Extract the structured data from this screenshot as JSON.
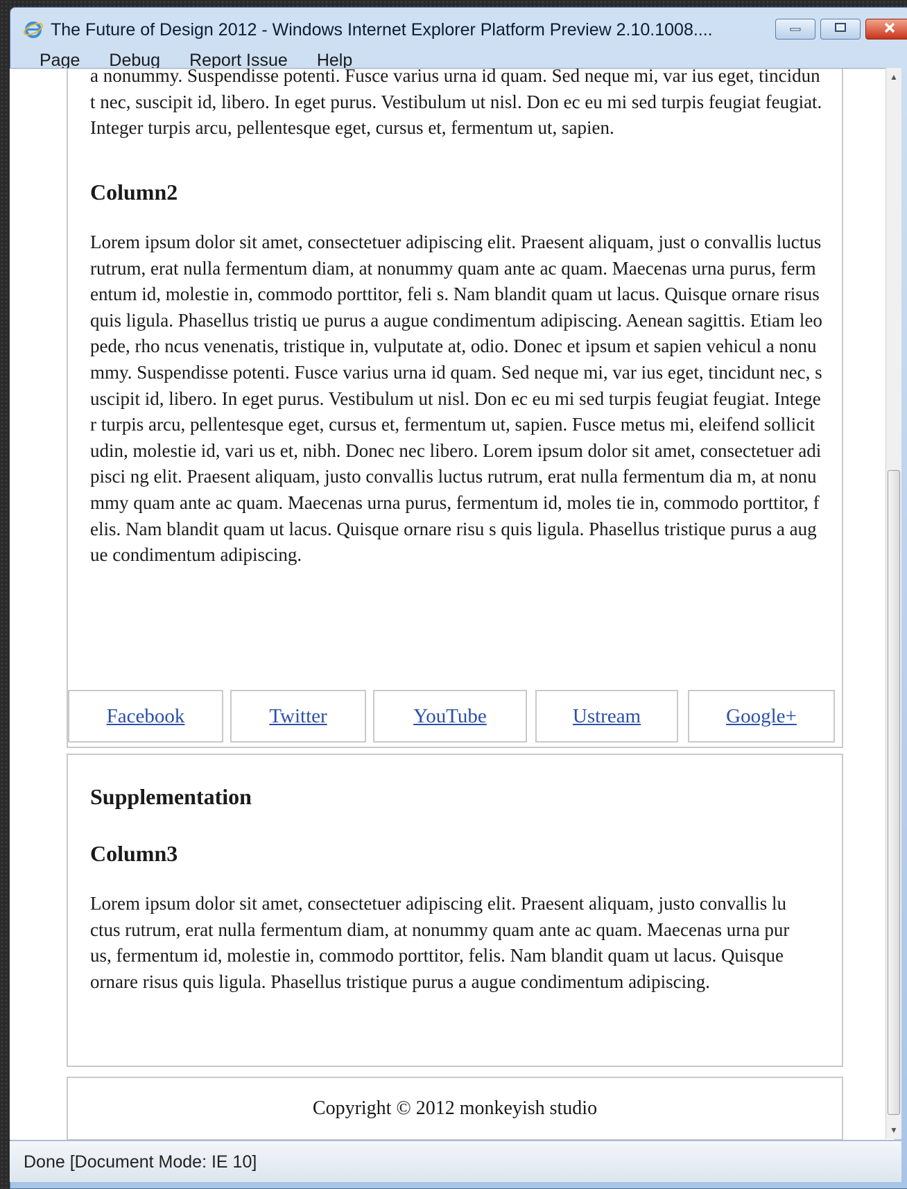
{
  "window": {
    "title": "The Future of Design 2012 - Windows Internet Explorer Platform Preview 2.10.1008....",
    "minimize_icon": "minimize-icon",
    "maximize_icon": "maximize-icon",
    "close_icon": "close-icon"
  },
  "menu": [
    "Page",
    "Debug",
    "Report Issue",
    "Help"
  ],
  "content": {
    "column1_tail": "a nonummy. Suspendisse potenti. Fusce varius urna id quam. Sed neque mi, var ius eget, tincidunt nec, suscipit id, libero. In eget purus. Vestibulum ut nisl. Don ec eu mi sed turpis feugiat feugiat. Integer turpis arcu, pellentesque eget, cursus et, fermentum ut, sapien.",
    "column2_heading": "Column2",
    "column2_text": "Lorem ipsum dolor sit amet, consectetuer adipiscing elit. Praesent aliquam, just o convallis luctus rutrum, erat nulla fermentum diam, at nonummy quam ante ac quam. Maecenas urna purus, fermentum id, molestie in, commodo porttitor, feli s. Nam blandit quam ut lacus. Quisque ornare risus quis ligula. Phasellus tristiq ue purus a augue condimentum adipiscing. Aenean sagittis. Etiam leo pede, rho ncus venenatis, tristique in, vulputate at, odio. Donec et ipsum et sapien vehicul a nonummy. Suspendisse potenti. Fusce varius urna id quam. Sed neque mi, var ius eget, tincidunt nec, suscipit id, libero. In eget purus. Vestibulum ut nisl. Don ec eu mi sed turpis feugiat feugiat. Integer turpis arcu, pellentesque eget, cursus et, fermentum ut, sapien. Fusce metus mi, eleifend sollicitudin, molestie id, vari us et, nibh. Donec nec libero. Lorem ipsum dolor sit amet, consectetuer adipisci ng elit. Praesent aliquam, justo convallis luctus rutrum, erat nulla fermentum dia m, at nonummy quam ante ac quam. Maecenas urna purus, fermentum id, moles tie in, commodo porttitor, felis. Nam blandit quam ut lacus. Quisque ornare risu s quis ligula. Phasellus tristique purus a augue condimentum adipiscing.",
    "links": [
      "Facebook",
      "Twitter",
      "YouTube",
      "Ustream",
      "Google+"
    ],
    "supplementation_heading": "Supplementation",
    "column3_heading": "Column3",
    "column3_text": "Lorem ipsum dolor sit amet, consectetuer adipiscing elit. Praesent aliquam, justo convallis luctus rutrum, erat nulla fermentum diam, at nonummy quam ante ac quam. Maecenas urna purus, fermentum id, molestie in, commodo porttitor, felis. Nam blandit quam ut lacus. Quisque ornare risus quis ligula. Phasellus tristique purus a augue condimentum adipiscing.",
    "copyright": "Copyright © 2012 monkeyish studio"
  },
  "status": "Done [Document Mode: IE 10]",
  "colors": {
    "link": "#2b4fa8",
    "border": "#c9c9c9",
    "chrome": "#cfe0f3"
  }
}
